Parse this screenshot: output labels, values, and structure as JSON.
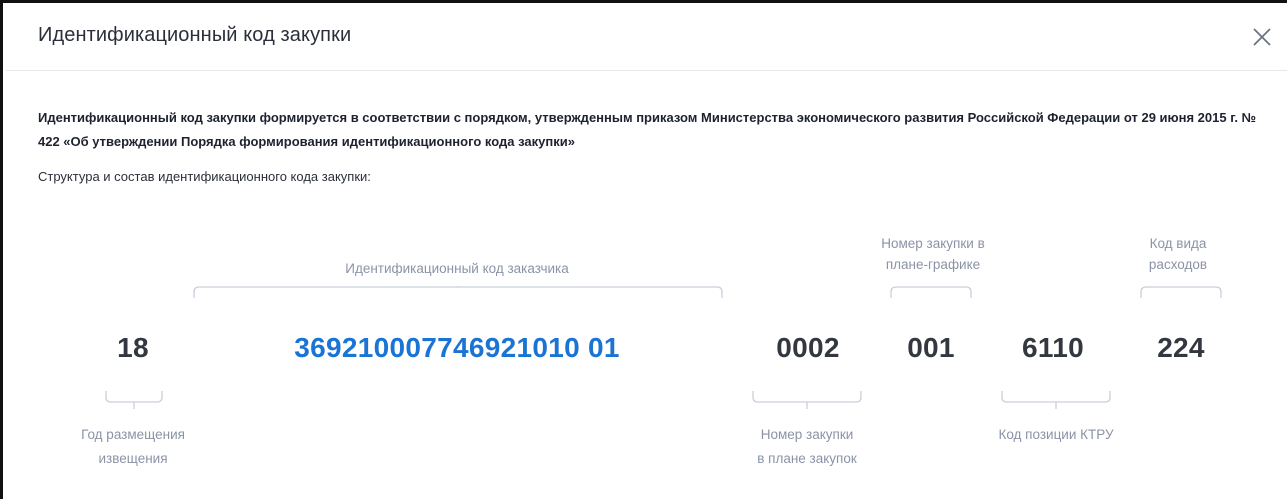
{
  "dialog": {
    "title": "Идентификационный код закупки",
    "close_icon": "close-icon"
  },
  "description": "Идентификационный код закупки формируется в соответствии с порядком, утвержденным приказом Министерства экономического развития Российской Федерации от 29 июня 2015 г. № 422 «Об утверждении Порядка формирования идентификационного кода закупки»",
  "subtitle": "Структура и состав идентификационного кода закупки:",
  "labels_top": {
    "customer_code": "Идентификационный код заказчика",
    "schedule_number": [
      "Номер закупки в",
      "плане-графике"
    ],
    "expense_code": [
      "Код вида",
      "расходов"
    ]
  },
  "segments": {
    "year": "18",
    "customer_code": "369210007746921010 01",
    "plan_number": "0002",
    "schedule_number": "001",
    "ktru_code": "6110",
    "expense_code": "224"
  },
  "labels_bottom": {
    "year": [
      "Год размещения",
      "извещения"
    ],
    "plan_number": [
      "Номер закупки",
      "в плане закупок"
    ],
    "ktru_code": "Код позиции КТРУ"
  },
  "colors": {
    "accent": "#1a74d4",
    "label": "#8b93a6",
    "bracket": "#c9cfdb"
  }
}
